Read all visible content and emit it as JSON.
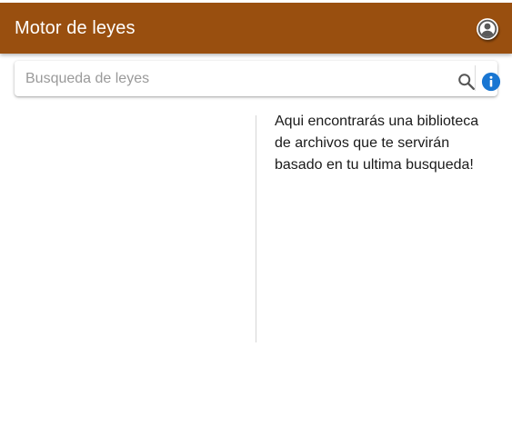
{
  "app_bar": {
    "title": "Motor de leyes",
    "background_color": "#994f0f",
    "account_icon": "account-circle-icon"
  },
  "search": {
    "placeholder": "Busqueda de leyes",
    "value": "",
    "search_icon": "search-icon",
    "info_icon": "info-icon",
    "info_color": "#1976d2"
  },
  "library": {
    "message": "Aqui encontrarás una biblioteca de archivos que te servirán basado en tu ultima busqueda!"
  }
}
